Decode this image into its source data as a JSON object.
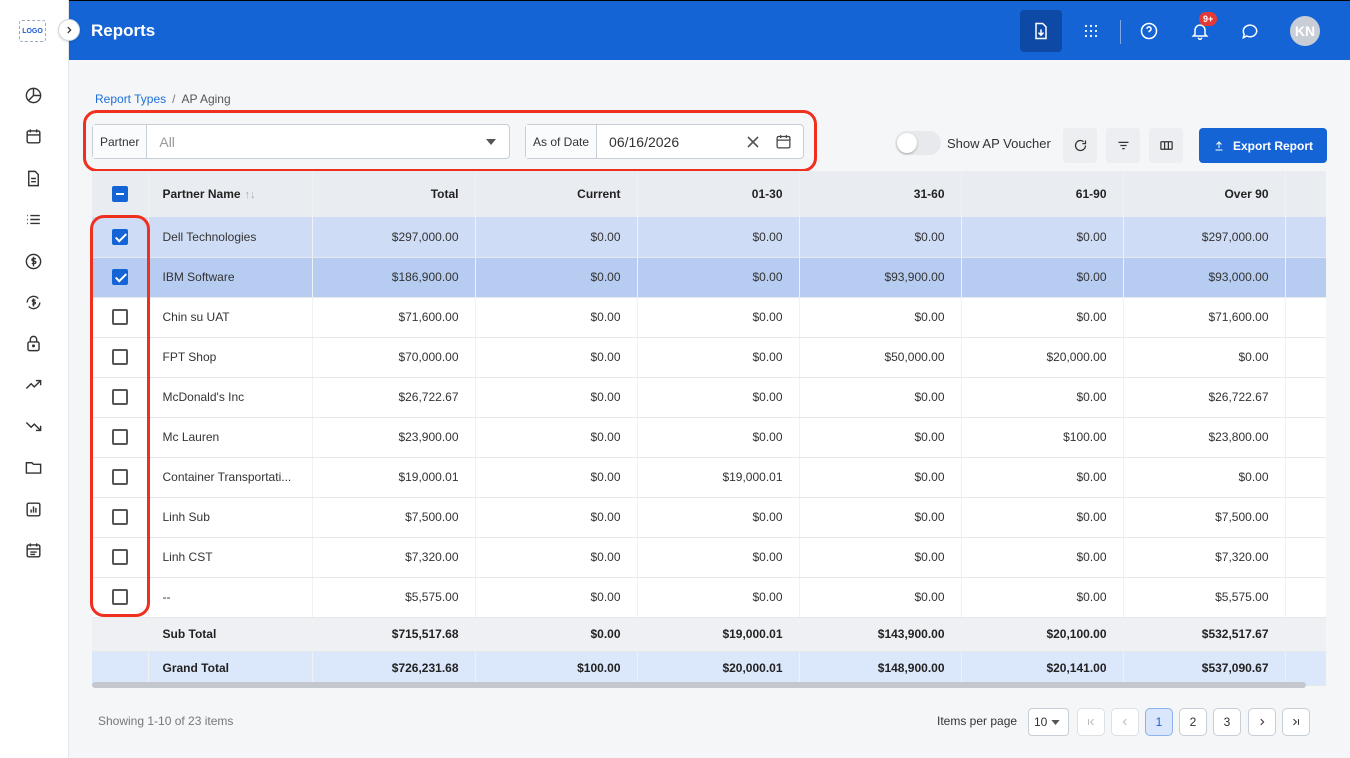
{
  "app": {
    "logo_text": "LOGO",
    "title": "Reports",
    "notification_badge": "9+",
    "avatar_initials": "KN"
  },
  "breadcrumb": {
    "root": "Report Types",
    "separator": "/",
    "current": "AP Aging"
  },
  "filters": {
    "partner_label": "Partner",
    "partner_value": "All",
    "date_label": "As of Date",
    "date_value": "06/16/2026"
  },
  "toolbar": {
    "show_voucher_label": "Show AP Voucher",
    "export_label": "Export Report"
  },
  "table": {
    "columns": [
      "Partner Name",
      "Total",
      "Current",
      "01-30",
      "31-60",
      "61-90",
      "Over 90"
    ],
    "rows": [
      {
        "checked": true,
        "name": "Dell Technologies",
        "total": "$297,000.00",
        "current": "$0.00",
        "d1_30": "$0.00",
        "d31_60": "$0.00",
        "d61_90": "$0.00",
        "over90": "$297,000.00"
      },
      {
        "checked": true,
        "name": "IBM Software",
        "total": "$186,900.00",
        "current": "$0.00",
        "d1_30": "$0.00",
        "d31_60": "$93,900.00",
        "d61_90": "$0.00",
        "over90": "$93,000.00"
      },
      {
        "checked": false,
        "name": "Chin su UAT",
        "total": "$71,600.00",
        "current": "$0.00",
        "d1_30": "$0.00",
        "d31_60": "$0.00",
        "d61_90": "$0.00",
        "over90": "$71,600.00"
      },
      {
        "checked": false,
        "name": "FPT Shop",
        "total": "$70,000.00",
        "current": "$0.00",
        "d1_30": "$0.00",
        "d31_60": "$50,000.00",
        "d61_90": "$20,000.00",
        "over90": "$0.00"
      },
      {
        "checked": false,
        "name": "McDonald's Inc",
        "total": "$26,722.67",
        "current": "$0.00",
        "d1_30": "$0.00",
        "d31_60": "$0.00",
        "d61_90": "$0.00",
        "over90": "$26,722.67"
      },
      {
        "checked": false,
        "name": "Mc Lauren",
        "total": "$23,900.00",
        "current": "$0.00",
        "d1_30": "$0.00",
        "d31_60": "$0.00",
        "d61_90": "$100.00",
        "over90": "$23,800.00"
      },
      {
        "checked": false,
        "name": "Container Transportati...",
        "total": "$19,000.01",
        "current": "$0.00",
        "d1_30": "$19,000.01",
        "d31_60": "$0.00",
        "d61_90": "$0.00",
        "over90": "$0.00"
      },
      {
        "checked": false,
        "name": "Linh Sub",
        "total": "$7,500.00",
        "current": "$0.00",
        "d1_30": "$0.00",
        "d31_60": "$0.00",
        "d61_90": "$0.00",
        "over90": "$7,500.00"
      },
      {
        "checked": false,
        "name": "Linh CST",
        "total": "$7,320.00",
        "current": "$0.00",
        "d1_30": "$0.00",
        "d31_60": "$0.00",
        "d61_90": "$0.00",
        "over90": "$7,320.00"
      },
      {
        "checked": false,
        "name": "--",
        "total": "$5,575.00",
        "current": "$0.00",
        "d1_30": "$0.00",
        "d31_60": "$0.00",
        "d61_90": "$0.00",
        "over90": "$5,575.00"
      }
    ],
    "subtotal": {
      "label": "Sub Total",
      "total": "$715,517.68",
      "current": "$0.00",
      "d1_30": "$19,000.01",
      "d31_60": "$143,900.00",
      "d61_90": "$20,100.00",
      "over90": "$532,517.67"
    },
    "grandtotal": {
      "label": "Grand Total",
      "total": "$726,231.68",
      "current": "$100.00",
      "d1_30": "$20,000.01",
      "d31_60": "$148,900.00",
      "d61_90": "$20,141.00",
      "over90": "$537,090.67"
    }
  },
  "pagination": {
    "summary": "Showing 1-10 of 23 items",
    "items_per_page_label": "Items per page",
    "items_per_page": "10",
    "pages": [
      "1",
      "2",
      "3"
    ],
    "current_page": "1"
  },
  "colors": {
    "primary": "#1464d6",
    "highlight": "#f0301f"
  }
}
